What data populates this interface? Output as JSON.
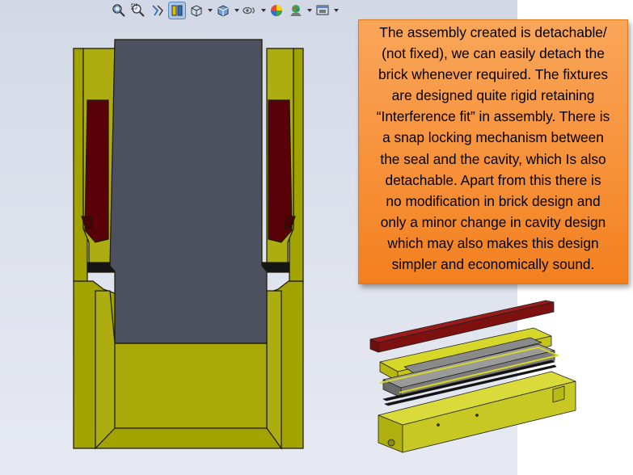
{
  "toolbar": {
    "buttons": [
      {
        "icon": "zoom-to-fit-icon",
        "has_dropdown": false,
        "active": false
      },
      {
        "icon": "zoom-to-area-icon",
        "has_dropdown": false,
        "active": false
      },
      {
        "icon": "previous-view-icon",
        "has_dropdown": false,
        "active": false
      },
      {
        "icon": "section-view-icon",
        "has_dropdown": false,
        "active": true
      },
      {
        "icon": "view-orientation-icon",
        "has_dropdown": true,
        "active": false
      },
      {
        "icon": "display-style-icon",
        "has_dropdown": true,
        "active": false
      },
      {
        "icon": "hide-show-items-icon",
        "has_dropdown": true,
        "active": false
      },
      {
        "icon": "edit-appearance-icon",
        "has_dropdown": false,
        "active": false
      },
      {
        "icon": "apply-scene-icon",
        "has_dropdown": true,
        "active": false
      },
      {
        "icon": "view-settings-icon",
        "has_dropdown": true,
        "active": false
      }
    ]
  },
  "callout": {
    "lines": [
      "The assembly created is detachable/",
      "(not fixed), we can easily detach the",
      "brick whenever required. The fixtures",
      "are designed quite rigid retaining",
      "“Interference fit” in assembly. There is",
      "a snap locking mechanism between",
      "the seal and the cavity, which Is also",
      "detachable.  Apart from this there is",
      "no modification in brick design and",
      "only a minor change in cavity design",
      "which may also makes this design",
      "simpler and economically sound."
    ]
  },
  "colors": {
    "olive_body": "#a3a300",
    "dark_red_seal": "#5a0008",
    "brick_gray": "#4d515f",
    "callout_orange": "#f7913a",
    "viewport_bg": "#d9dde9"
  }
}
